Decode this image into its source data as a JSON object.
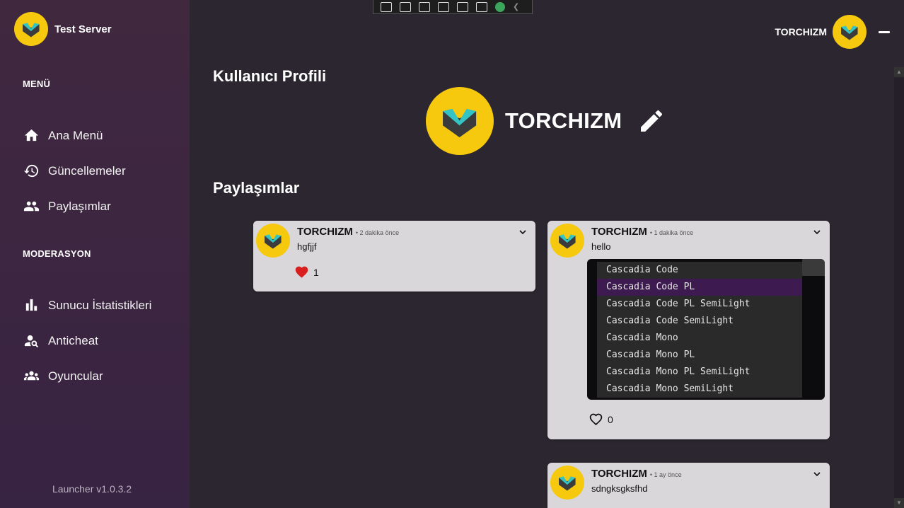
{
  "app": {
    "title": "Test Server"
  },
  "toolbar": {
    "icons": [
      "select-element-icon",
      "record-icon",
      "pointer-icon",
      "frame-icon",
      "inspect-icon",
      "hot-reload-icon",
      "check-icon",
      "chevron-left-icon"
    ]
  },
  "sidebar": {
    "menu_title": "MENÜ",
    "menu_items": [
      {
        "label": "Ana Menü",
        "icon": "home-icon"
      },
      {
        "label": "Güncellemeler",
        "icon": "history-icon"
      },
      {
        "label": "Paylaşımlar",
        "icon": "people-icon"
      }
    ],
    "moderation_title": "MODERASYON",
    "moderation_items": [
      {
        "label": "Sunucu İstatistikleri",
        "icon": "bar-chart-icon"
      },
      {
        "label": "Anticheat",
        "icon": "user-search-icon"
      },
      {
        "label": "Oyuncular",
        "icon": "group-icon"
      }
    ],
    "version": "Launcher v1.0.3.2"
  },
  "user": {
    "name": "TORCHIZM"
  },
  "profile": {
    "title": "Kullanıcı Profili",
    "name": "TORCHIZM"
  },
  "posts_title": "Paylaşımlar",
  "posts": [
    {
      "author": "TORCHIZM",
      "time": "• 2 dakika önce",
      "text": "hgfjjf",
      "likes": "1",
      "liked": true
    },
    {
      "author": "TORCHIZM",
      "time": "• 1 dakika önce",
      "text": "hello",
      "likes": "0",
      "liked": false,
      "image_items": [
        "Cascadia Code",
        "Cascadia Code PL",
        "Cascadia Code PL SemiLight",
        "Cascadia Code SemiLight",
        "Cascadia Mono",
        "Cascadia Mono PL",
        "Cascadia Mono PL SemiLight",
        "Cascadia Mono SemiLight"
      ]
    },
    {
      "author": "TORCHIZM",
      "time": "• 1 ay önce",
      "text": "sdngksgksfhd"
    }
  ],
  "colors": {
    "accent_yellow": "#f6c90e",
    "sidebar": "#3b2541",
    "like_red": "#d81e1e",
    "selected_item": "#3d1a4f"
  }
}
